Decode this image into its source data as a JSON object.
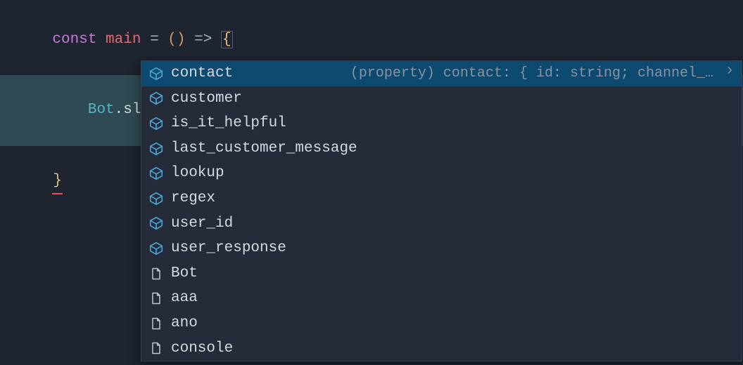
{
  "code": {
    "line1": {
      "const": "const",
      "main": "main",
      "eq": "=",
      "parens": "()",
      "arrow": "=>",
      "brace": "{"
    },
    "line2": {
      "indent": "    ",
      "obj": "Bot",
      "dot1": ".",
      "prop": "slots",
      "dot2": "."
    },
    "line3": {
      "brace": "}"
    }
  },
  "completion": {
    "items": [
      {
        "kind": "field",
        "label": "contact",
        "detail": "(property) contact: { id: string; channel_…",
        "selected": true,
        "hasMore": true
      },
      {
        "kind": "field",
        "label": "customer"
      },
      {
        "kind": "field",
        "label": "is_it_helpful"
      },
      {
        "kind": "field",
        "label": "last_customer_message"
      },
      {
        "kind": "field",
        "label": "lookup"
      },
      {
        "kind": "field",
        "label": "regex"
      },
      {
        "kind": "field",
        "label": "user_id"
      },
      {
        "kind": "field",
        "label": "user_response"
      },
      {
        "kind": "file",
        "label": "Bot"
      },
      {
        "kind": "file",
        "label": "aaa"
      },
      {
        "kind": "file",
        "label": "ano"
      },
      {
        "kind": "file",
        "label": "console"
      }
    ]
  },
  "colors": {
    "bg": "#1e2430",
    "popupBg": "#252b38",
    "selectedBg": "#0d4a6f",
    "iconField": "#4aa5d6",
    "iconFile": "#c0c7d4",
    "detailText": "#8a93a2"
  }
}
